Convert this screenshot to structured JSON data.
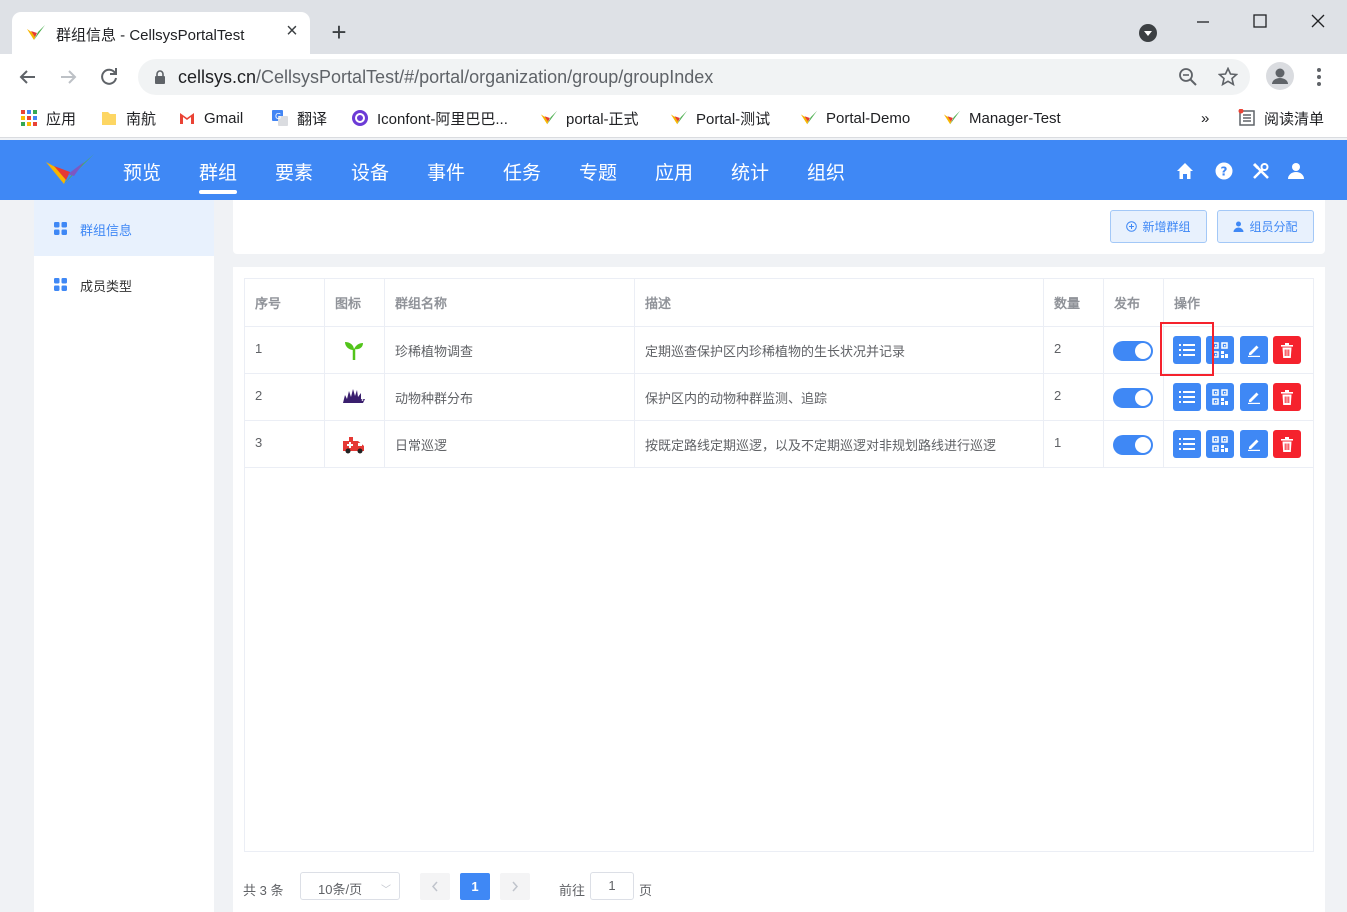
{
  "browser": {
    "tab_title": "群组信息 - CellsysPortalTest",
    "url_host": "cellsys.cn",
    "url_path": "/CellsysPortalTest/#/portal/organization/group/groupIndex",
    "bookmarks": [
      {
        "label": "应用",
        "icon": "apps-grid-icon"
      },
      {
        "label": "南航",
        "icon": "folder-icon"
      },
      {
        "label": "Gmail",
        "icon": "gmail-icon"
      },
      {
        "label": "翻译",
        "icon": "translate-icon"
      },
      {
        "label": "Iconfont-阿里巴巴...",
        "icon": "iconfont-icon"
      },
      {
        "label": "portal-正式",
        "icon": "cellsys-logo-icon"
      },
      {
        "label": "Portal-测试",
        "icon": "cellsys-logo-icon"
      },
      {
        "label": "Portal-Demo",
        "icon": "cellsys-logo-icon"
      },
      {
        "label": "Manager-Test",
        "icon": "cellsys-logo-icon"
      }
    ],
    "more_bookmarks": "»",
    "reading_list": "阅读清单"
  },
  "nav": {
    "items": [
      "预览",
      "群组",
      "要素",
      "设备",
      "事件",
      "任务",
      "专题",
      "应用",
      "统计",
      "组织"
    ],
    "active": "群组"
  },
  "sidebar": {
    "items": [
      {
        "label": "群组信息",
        "active": true
      },
      {
        "label": "成员类型",
        "active": false
      }
    ]
  },
  "actions": {
    "add_group": "新增群组",
    "assign_members": "组员分配"
  },
  "table": {
    "headers": [
      "序号",
      "图标",
      "群组名称",
      "描述",
      "数量",
      "发布",
      "操作"
    ],
    "rows": [
      {
        "index": "1",
        "icon": "sprout-icon",
        "name": "珍稀植物调查",
        "desc": "定期巡查保护区内珍稀植物的生长状况并记录",
        "count": "2",
        "published": true
      },
      {
        "index": "2",
        "icon": "hedgehog-icon",
        "name": "动物种群分布",
        "desc": "保护区内的动物种群监测、追踪",
        "count": "2",
        "published": true
      },
      {
        "index": "3",
        "icon": "ambulance-icon",
        "name": "日常巡逻",
        "desc": "按既定路线定期巡逻，以及不定期巡逻对非规划路线进行巡逻",
        "count": "1",
        "published": true
      }
    ]
  },
  "pagination": {
    "total": "共 3 条",
    "page_size": "10条/页",
    "current_page": "1",
    "goto_label": "前往",
    "goto_value": "1",
    "page_suffix": "页"
  },
  "colors": {
    "primary": "#3f88f5",
    "danger": "#f5222d"
  }
}
